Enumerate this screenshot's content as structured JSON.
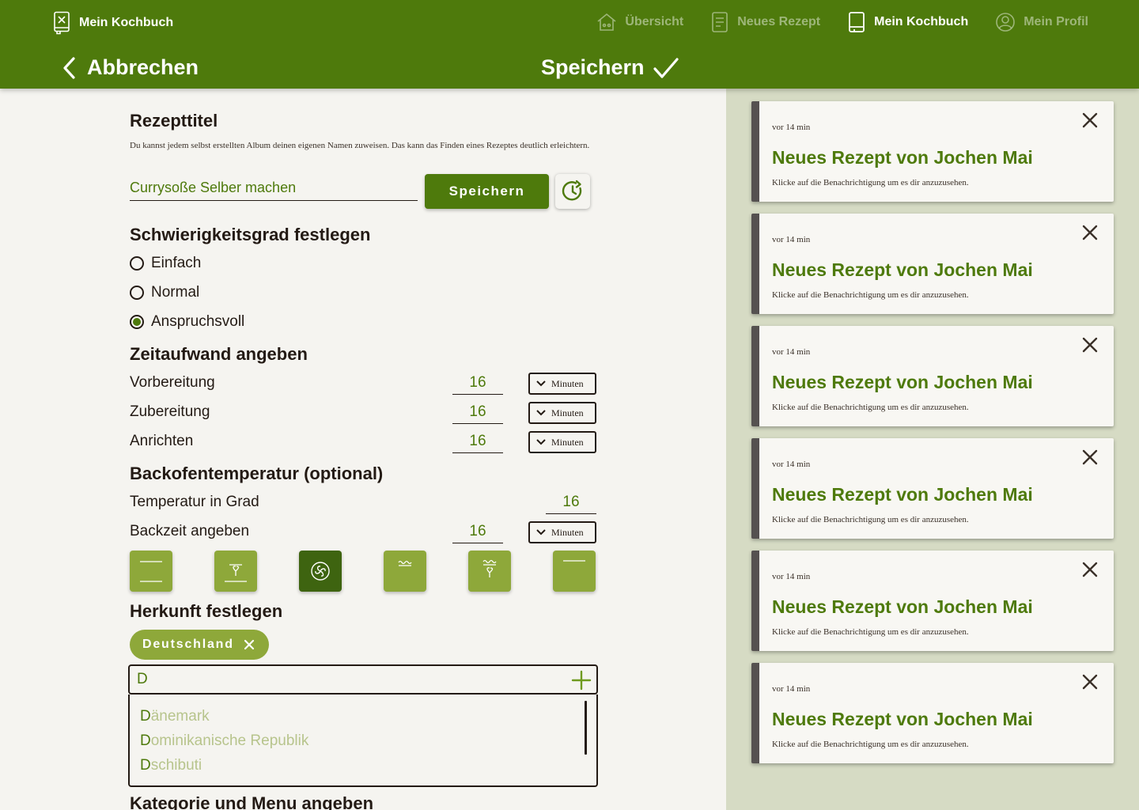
{
  "header": {
    "brand": "Mein Kochbuch",
    "nav": [
      "Übersicht",
      "Neues Rezept",
      "Mein Kochbuch",
      "Mein Profil"
    ],
    "active_nav": "Mein Kochbuch",
    "cancel_label": "Abbrechen",
    "save_label": "Speichern"
  },
  "form": {
    "title_heading": "Rezepttitel",
    "title_desc": "Du kannst jedem selbst erstellten Album deinen eigenen Namen zuweisen. Das kann das Finden eines Rezeptes deutlich erleichtern.",
    "title_value": "Currysoße Selber machen",
    "save_button": "Speichern",
    "difficulty_heading": "Schwierigkeitsgrad festlegen",
    "difficulty": [
      {
        "label": "Einfach",
        "selected": false
      },
      {
        "label": "Normal",
        "selected": false
      },
      {
        "label": "Anspruchsvoll",
        "selected": true
      }
    ],
    "time_heading": "Zeitaufwand angeben",
    "times": [
      {
        "label": "Vorbereitung",
        "value": "16",
        "unit": "Minuten"
      },
      {
        "label": "Zubereitung",
        "value": "16",
        "unit": "Minuten"
      },
      {
        "label": "Anrichten",
        "value": "16",
        "unit": "Minuten"
      }
    ],
    "oven_heading": "Backofentemperatur (optional)",
    "temp_label": "Temperatur in Grad",
    "temp_value": "16",
    "bake_label": "Backzeit angeben",
    "bake_value": "16",
    "bake_unit": "Minuten",
    "oven_modes": [
      {
        "icon": "top-bottom-heat-icon",
        "active": false
      },
      {
        "icon": "fan-bottom-heat-icon",
        "active": false
      },
      {
        "icon": "circulating-air-icon",
        "active": true
      },
      {
        "icon": "grill-icon",
        "active": false
      },
      {
        "icon": "fan-grill-icon",
        "active": false
      },
      {
        "icon": "top-heat-icon",
        "active": false
      }
    ],
    "origin_heading": "Herkunft festlegen",
    "origin_chip": "Deutschland",
    "origin_input": "D",
    "origin_options": [
      {
        "match": "D",
        "rest": "änemark"
      },
      {
        "match": "D",
        "rest": "ominikanische Republik"
      },
      {
        "match": "D",
        "rest": "schibuti"
      }
    ],
    "category_heading": "Kategorie und Menu angeben"
  },
  "notifications": [
    {
      "time": "vor 14 min",
      "title": "Neues Rezept von Jochen Mai",
      "text": "Klicke auf die Benachrichtigung um es dir anzuzusehen."
    },
    {
      "time": "vor 14 min",
      "title": "Neues Rezept von Jochen Mai",
      "text": "Klicke auf die Benachrichtigung um es dir anzuzusehen."
    },
    {
      "time": "vor 14 min",
      "title": "Neues Rezept von Jochen Mai",
      "text": "Klicke auf die Benachrichtigung um es dir anzuzusehen."
    },
    {
      "time": "vor 14 min",
      "title": "Neues Rezept von Jochen Mai",
      "text": "Klicke auf die Benachrichtigung um es dir anzuzusehen."
    },
    {
      "time": "vor 14 min",
      "title": "Neues Rezept von Jochen Mai",
      "text": "Klicke auf die Benachrichtigung um es dir anzuzusehen."
    },
    {
      "time": "vor 14 min",
      "title": "Neues Rezept von Jochen Mai",
      "text": "Klicke auf die Benachrichtigung um es dir anzuzusehen."
    }
  ],
  "colors": {
    "primary": "#4e7a0c",
    "secondary": "#8ea83a",
    "panel": "#d6dbc4",
    "background": "#f5f4f0",
    "text": "#231a14"
  }
}
